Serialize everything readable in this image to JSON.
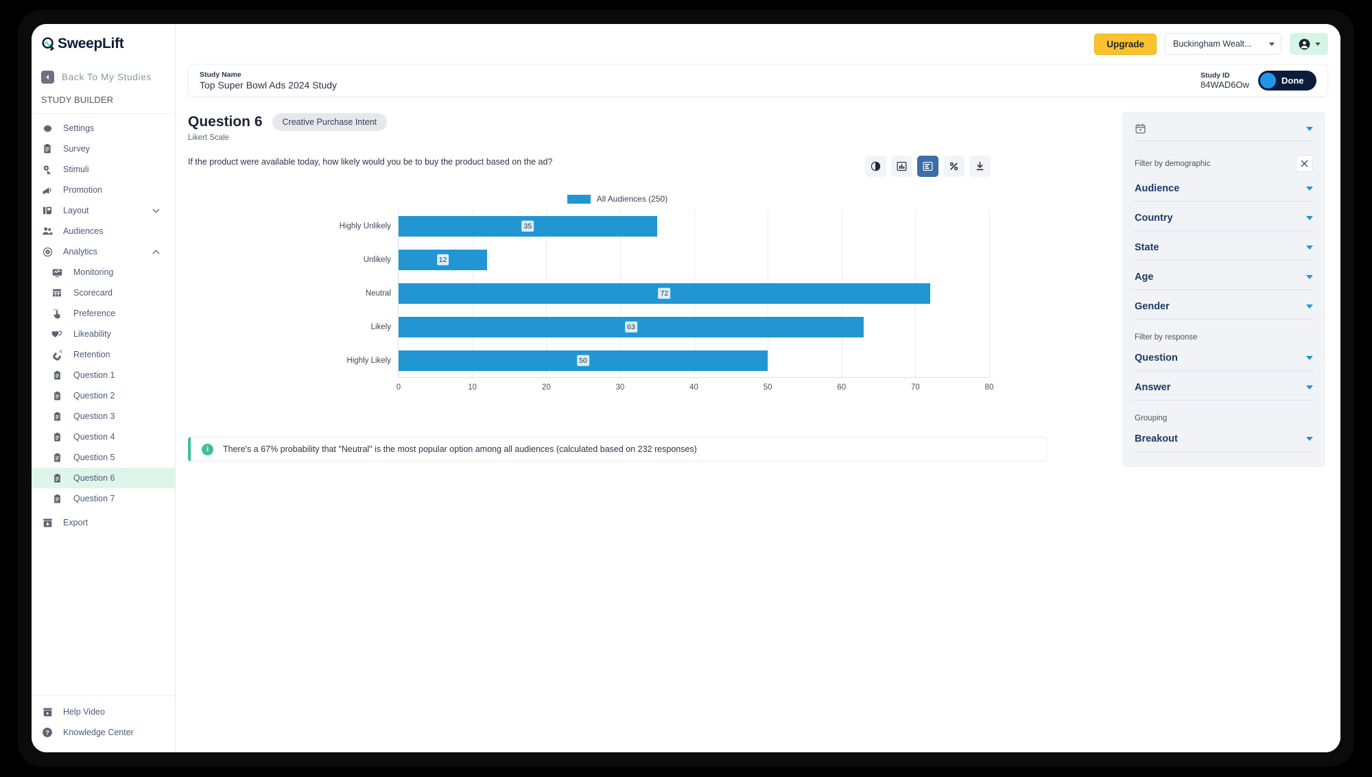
{
  "brand": {
    "name": "SweepLift",
    "accent": "#2196d3",
    "highlight": "#dff5ea"
  },
  "sidebar": {
    "back_label": "Back To My Studies",
    "section_label": "STUDY BUILDER",
    "items": [
      {
        "label": "Settings",
        "icon": "gear-icon"
      },
      {
        "label": "Survey",
        "icon": "clipboard-icon"
      },
      {
        "label": "Stimuli",
        "icon": "stimuli-icon"
      },
      {
        "label": "Promotion",
        "icon": "megaphone-icon"
      },
      {
        "label": "Layout",
        "icon": "layout-icon",
        "caret": "⌄"
      },
      {
        "label": "Audiences",
        "icon": "people-icon"
      },
      {
        "label": "Analytics",
        "icon": "analytics-icon",
        "caret": "⌃"
      }
    ],
    "sub_items": [
      {
        "label": "Monitoring",
        "icon": "monitor-icon",
        "active": false
      },
      {
        "label": "Scorecard",
        "icon": "grid-icon",
        "active": false
      },
      {
        "label": "Preference",
        "icon": "tap-icon",
        "active": false
      },
      {
        "label": "Likeability",
        "icon": "hearts-icon",
        "active": false
      },
      {
        "label": "Retention",
        "icon": "magnet-icon",
        "active": false
      },
      {
        "label": "Question 1",
        "icon": "clipboard-icon",
        "active": false
      },
      {
        "label": "Question 2",
        "icon": "clipboard-icon",
        "active": false
      },
      {
        "label": "Question 3",
        "icon": "clipboard-icon",
        "active": false
      },
      {
        "label": "Question 4",
        "icon": "clipboard-icon",
        "active": false
      },
      {
        "label": "Question 5",
        "icon": "clipboard-icon",
        "active": false
      },
      {
        "label": "Question 6",
        "icon": "clipboard-icon",
        "active": true
      },
      {
        "label": "Question 7",
        "icon": "clipboard-icon",
        "active": false
      }
    ],
    "export": {
      "label": "Export",
      "icon": "export-icon"
    },
    "bottom_items": [
      {
        "label": "Help Video",
        "icon": "video-icon"
      },
      {
        "label": "Knowledge Center",
        "icon": "question-icon"
      }
    ]
  },
  "topbar": {
    "upgrade_label": "Upgrade",
    "org_name": "Buckingham Wealt...",
    "account_icon": "account-circle-icon"
  },
  "study": {
    "name_key": "Study Name",
    "name_value": "Top Super Bowl Ads 2024 Study",
    "id_key": "Study ID",
    "id_value": "84WAD6Ow",
    "status_label": "Done"
  },
  "question": {
    "title": "Question 6",
    "chip": "Creative Purchase Intent",
    "type": "Likert Scale",
    "text": "If the product were available today, how likely would you be to buy the product based on the ad?"
  },
  "chart_toolbar": [
    {
      "icon": "pie-chart-icon",
      "active": false
    },
    {
      "icon": "bar-chart-icon",
      "active": false
    },
    {
      "icon": "horizontal-bar-icon",
      "active": true
    },
    {
      "icon": "percent-icon",
      "active": false
    },
    {
      "icon": "download-icon",
      "active": false
    }
  ],
  "callout": {
    "icon": "info-icon",
    "text": "There's a 67% probability that \"Neutral\" is the most popular option among all audiences (calculated based on 232 responses)"
  },
  "filters": {
    "date_icon": "calendar-icon",
    "demographic_label": "Filter by demographic",
    "close_icon": "close-icon",
    "demographic_rows": [
      "Audience",
      "Country",
      "State",
      "Age",
      "Gender"
    ],
    "response_label": "Filter by response",
    "response_rows": [
      "Question",
      "Answer"
    ],
    "grouping_label": "Grouping",
    "grouping_rows": [
      "Breakout"
    ]
  },
  "chart_data": {
    "type": "bar",
    "orientation": "horizontal",
    "title": "",
    "categories": [
      "Highly Unlikely",
      "Unlikely",
      "Neutral",
      "Likely",
      "Highly Likely"
    ],
    "values": [
      35,
      12,
      72,
      63,
      50
    ],
    "series": [
      {
        "name": "All Audiences (250)",
        "color": "#2196d3",
        "values": [
          35,
          12,
          72,
          63,
          50
        ]
      }
    ],
    "legend": [
      "All Audiences (250)"
    ],
    "legend_position": "top-center",
    "xlabel": "",
    "ylabel": "",
    "xlim": [
      0,
      80
    ],
    "xticks": [
      0,
      10,
      20,
      30,
      40,
      50,
      60,
      70,
      80
    ],
    "grid": true,
    "data_labels": [
      35,
      12,
      72,
      63,
      50
    ]
  }
}
